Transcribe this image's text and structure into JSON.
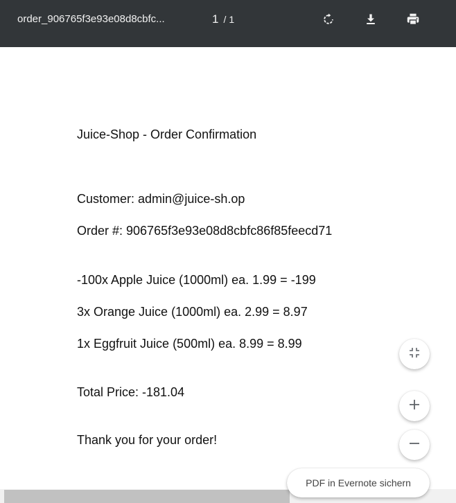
{
  "toolbar": {
    "filename": "order_906765f3e93e08d8cbfc...",
    "page_current": "1",
    "page_separator": "/",
    "page_total": "1",
    "icons": [
      "rotate-icon",
      "download-icon",
      "print-icon"
    ],
    "background_color": "#323639"
  },
  "document": {
    "title": "Juice-Shop - Order Confirmation",
    "customer": "Customer: admin@juice-sh.op",
    "order_number": "Order #: 906765f3e93e08d8cbfc86f85feecd71",
    "items": [
      "-100x Apple Juice (1000ml) ea. 1.99 = -199",
      "3x Orange Juice (1000ml) ea. 2.99 = 8.97",
      "1x Eggfruit Juice (500ml) ea. 8.99 = 8.99"
    ],
    "total": "Total Price: -181.04",
    "thanks": "Thank you for your order!"
  },
  "controls": {
    "fit_icon": "fit-to-page-icon",
    "zoom_in_icon": "plus-icon",
    "zoom_out_icon": "minus-icon",
    "evernote_label": "PDF in Evernote sichern"
  }
}
